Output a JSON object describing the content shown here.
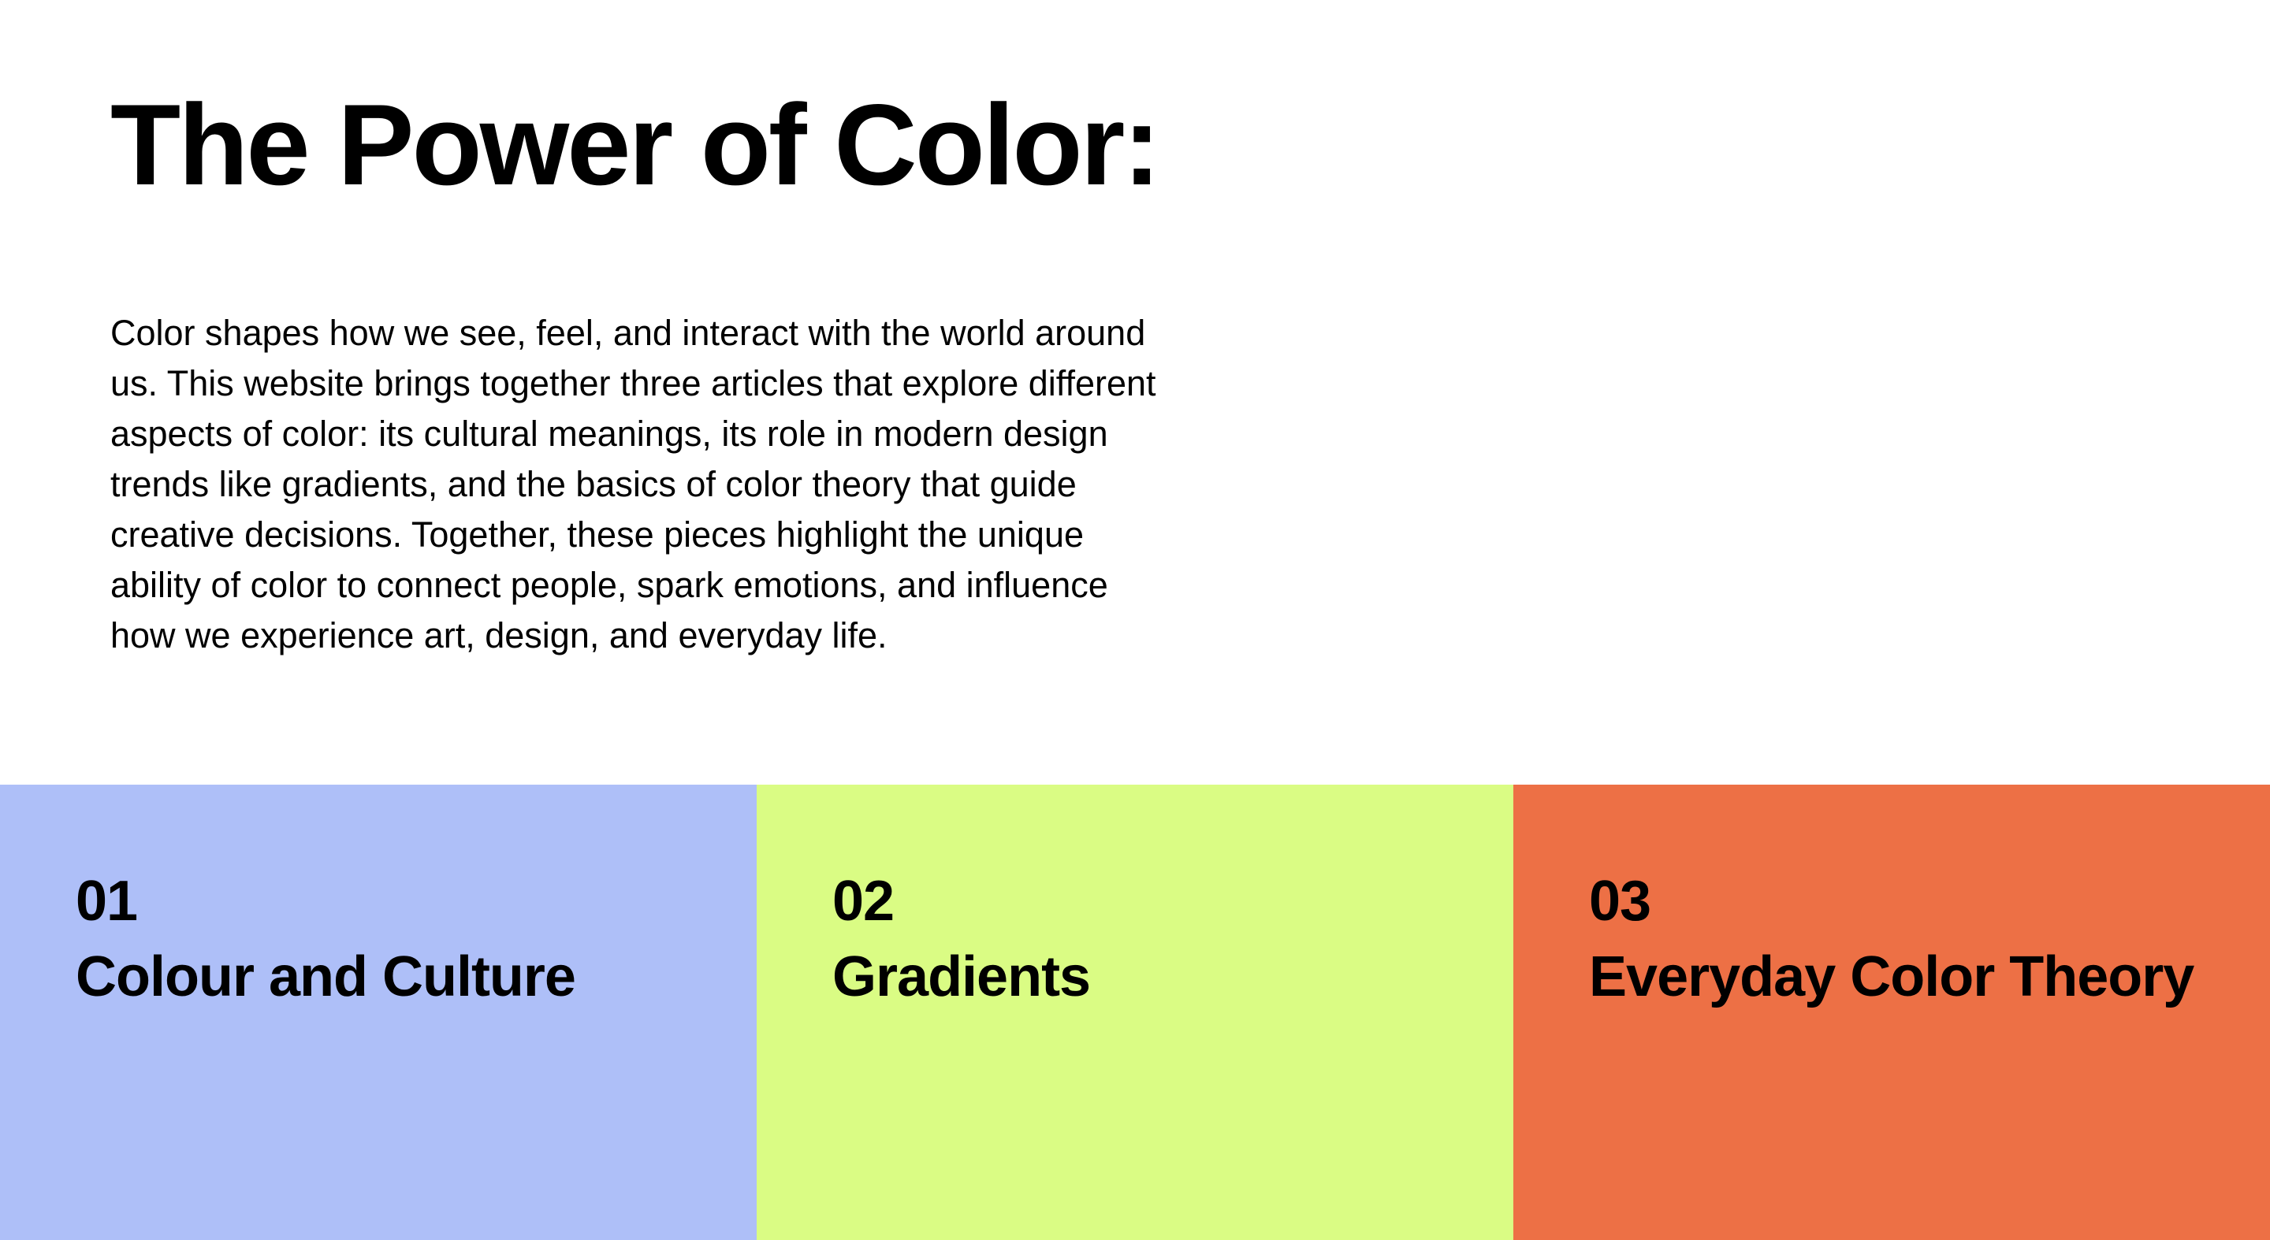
{
  "hero": {
    "title": "The Power of Color:",
    "intro": "Color shapes how we see, feel, and interact with the world around us. This website brings together three articles that explore different aspects of color: its cultural meanings, its role in modern design trends like gradients, and the basics of color theory that guide creative decisions. Together, these pieces highlight the unique ability of color to connect people, spark emotions, and influence how we experience art, design, and everyday life."
  },
  "articles": [
    {
      "number": "01",
      "title": "Colour and Culture",
      "color": "#aebff8"
    },
    {
      "number": "02",
      "title": "Gradients",
      "color": "#dafc84"
    },
    {
      "number": "03",
      "title": "Everyday Color Theory",
      "color": "#ed7045"
    }
  ],
  "colors": {
    "background": "#ffffff",
    "text": "#000000"
  }
}
